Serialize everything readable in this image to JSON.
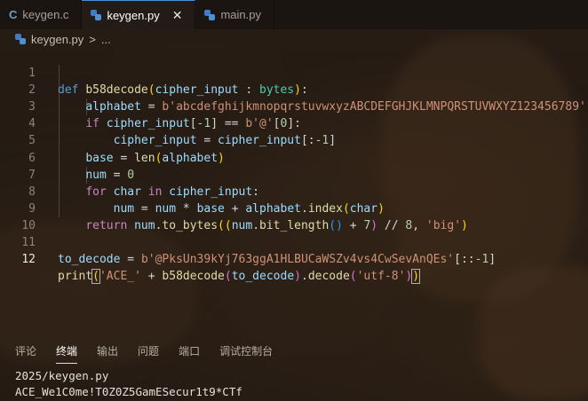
{
  "tabs": [
    {
      "label": "keygen.c",
      "icon": "c-file-icon"
    },
    {
      "label": "keygen.py",
      "icon": "python-file-icon",
      "active": true
    },
    {
      "label": "main.py",
      "icon": "python-file-icon"
    }
  ],
  "breadcrumb": {
    "file": "keygen.py",
    "sep": ">",
    "rest": "..."
  },
  "line_numbers": [
    "1",
    "2",
    "3",
    "4",
    "5",
    "6",
    "7",
    "8",
    "9",
    "10",
    "11",
    "12"
  ],
  "code": {
    "l1": {
      "def": "def",
      "name": "b58decode",
      "p_open": "(",
      "arg": "cipher_input",
      "colon": " : ",
      "type": "bytes",
      "p_close": ")",
      "end": ":"
    },
    "l2": {
      "var": "alphabet",
      "eq": " = ",
      "str": "b'abcdefghijkmnopqrstuvwxyzABCDEFGHJKLMNPQRSTUVWXYZ123456789'"
    },
    "l3": {
      "kw": "if",
      "var": "cipher_input",
      "idx": "[",
      "neg": "-1",
      "idx_c": "]",
      "eq": " == ",
      "str": "b'@'",
      "i2": "[",
      "zero": "0",
      "i2c": "]",
      "end": ":"
    },
    "l4": {
      "var": "cipher_input",
      "eq": " = ",
      "var2": "cipher_input",
      "slice": "[:",
      "neg": "-1",
      "slice_c": "]"
    },
    "l5": {
      "var": "base",
      "eq": " = ",
      "fn": "len",
      "p": "(",
      "arg": "alphabet",
      "pc": ")"
    },
    "l6": {
      "var": "num",
      "eq": " = ",
      "num": "0"
    },
    "l7": {
      "kw": "for",
      "var": "char",
      "in": "in",
      "var2": "cipher_input",
      "end": ":"
    },
    "l8": {
      "var": "num",
      "eq": " = ",
      "var2": "num",
      "op": " * ",
      "var3": "base",
      "op2": " + ",
      "var4": "alphabet",
      "dot": ".",
      "fn": "index",
      "p": "(",
      "arg": "char",
      "pc": ")"
    },
    "l9": {
      "kw": "return",
      "var": "num",
      "dot": ".",
      "fn": "to_bytes",
      "p": "((",
      "var2": "num",
      "dot2": ".",
      "fn2": "bit_length",
      "call": "()",
      "op": " + ",
      "n7": "7",
      "pc": ")",
      "op2": " // ",
      "n8": "8",
      "comma": ", ",
      "str": "'big'",
      "pc2": ")"
    },
    "l11": {
      "var": "to_decode",
      "eq": " = ",
      "str": "b'@PksUn39kYj763ggA1HLBUCaWSZv4vs4CwSevAnQEs'",
      "slice": "[::",
      "neg": "-1",
      "slice_c": "]"
    },
    "l12": {
      "fn": "print",
      "p": "(",
      "str": "'ACE_'",
      "op": " + ",
      "fn2": "b58decode",
      "p2": "(",
      "var": "to_decode",
      "p2c": ")",
      "dot": ".",
      "fn3": "decode",
      "p3": "(",
      "str2": "'utf-8'",
      "p3c": ")",
      "pc": ")"
    }
  },
  "panel_tabs": [
    "评论",
    "终端",
    "输出",
    "问题",
    "端口",
    "调试控制台"
  ],
  "terminal": {
    "line1": "2025/keygen.py",
    "line2": "ACE_We1C0me!T0Z0Z5GamESecur1t9*CTf"
  }
}
